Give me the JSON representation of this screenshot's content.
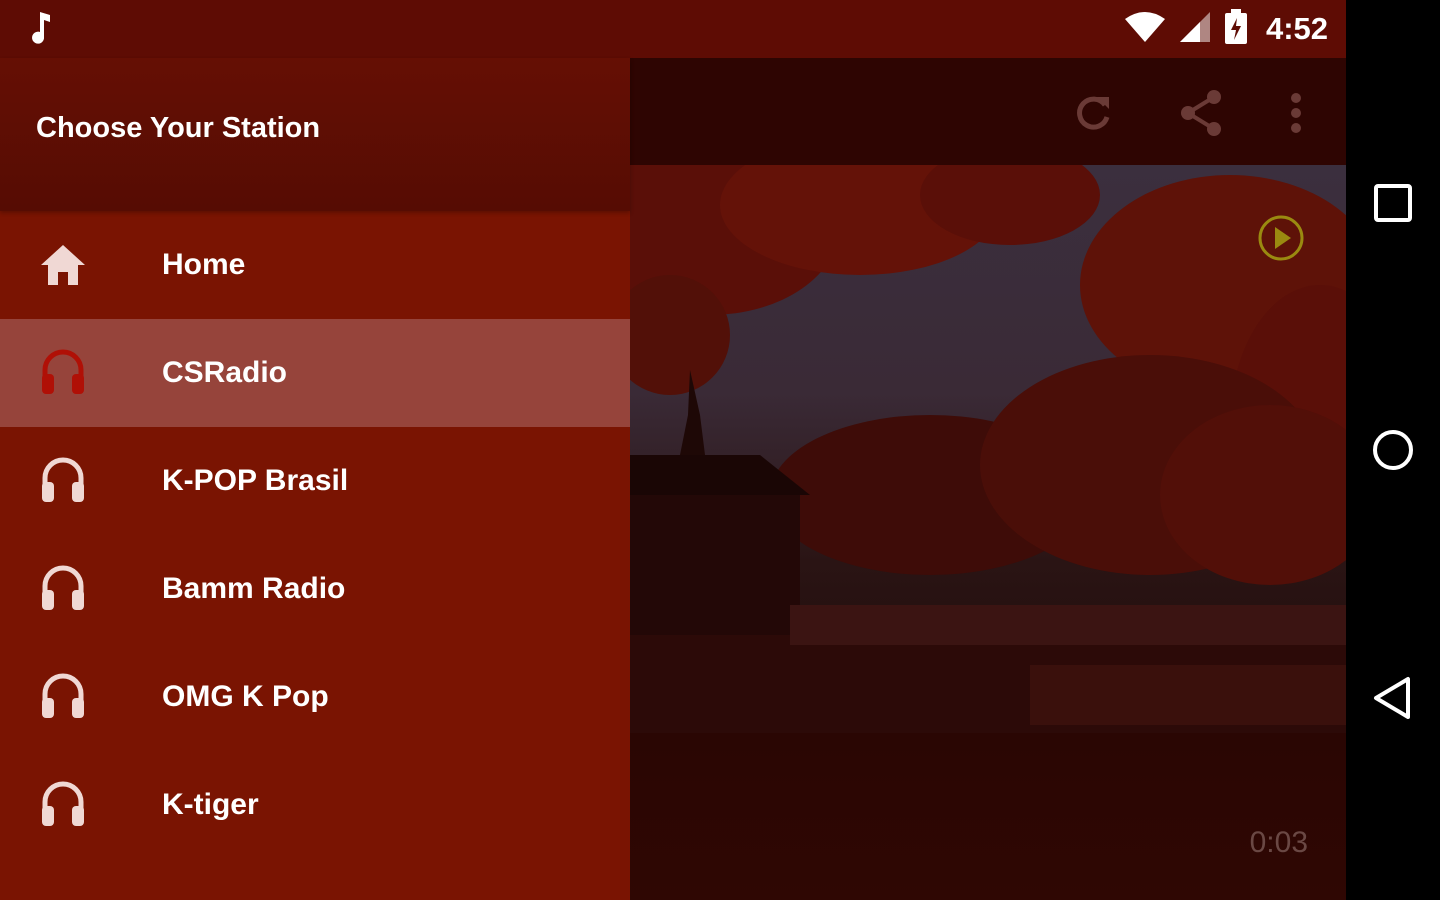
{
  "status_bar": {
    "time": "4:52",
    "icons": [
      "music-note-icon",
      "wifi-icon",
      "signal-icon",
      "battery-charging-icon"
    ]
  },
  "drawer": {
    "title": "Choose Your Station",
    "items": [
      {
        "label": "Home",
        "icon": "home-icon",
        "selected": false
      },
      {
        "label": "CSRadio",
        "icon": "headphones-icon",
        "selected": true
      },
      {
        "label": "K-POP Brasil",
        "icon": "headphones-icon",
        "selected": false
      },
      {
        "label": "Bamm Radio",
        "icon": "headphones-icon",
        "selected": false
      },
      {
        "label": "OMG K Pop",
        "icon": "headphones-icon",
        "selected": false
      },
      {
        "label": "K-tiger",
        "icon": "headphones-icon",
        "selected": false
      }
    ]
  },
  "toolbar": {
    "icons": [
      "refresh-icon",
      "share-icon",
      "more-vert-icon"
    ]
  },
  "player": {
    "elapsed": "0:03"
  },
  "colors": {
    "status_bar": "#5e0c04",
    "drawer": "#7a1402",
    "drawer_selected": "#96443b",
    "play_accent": "#9a8a10"
  },
  "nav_bar": {
    "icons": [
      "recents-icon",
      "home-circle-icon",
      "back-icon"
    ]
  }
}
